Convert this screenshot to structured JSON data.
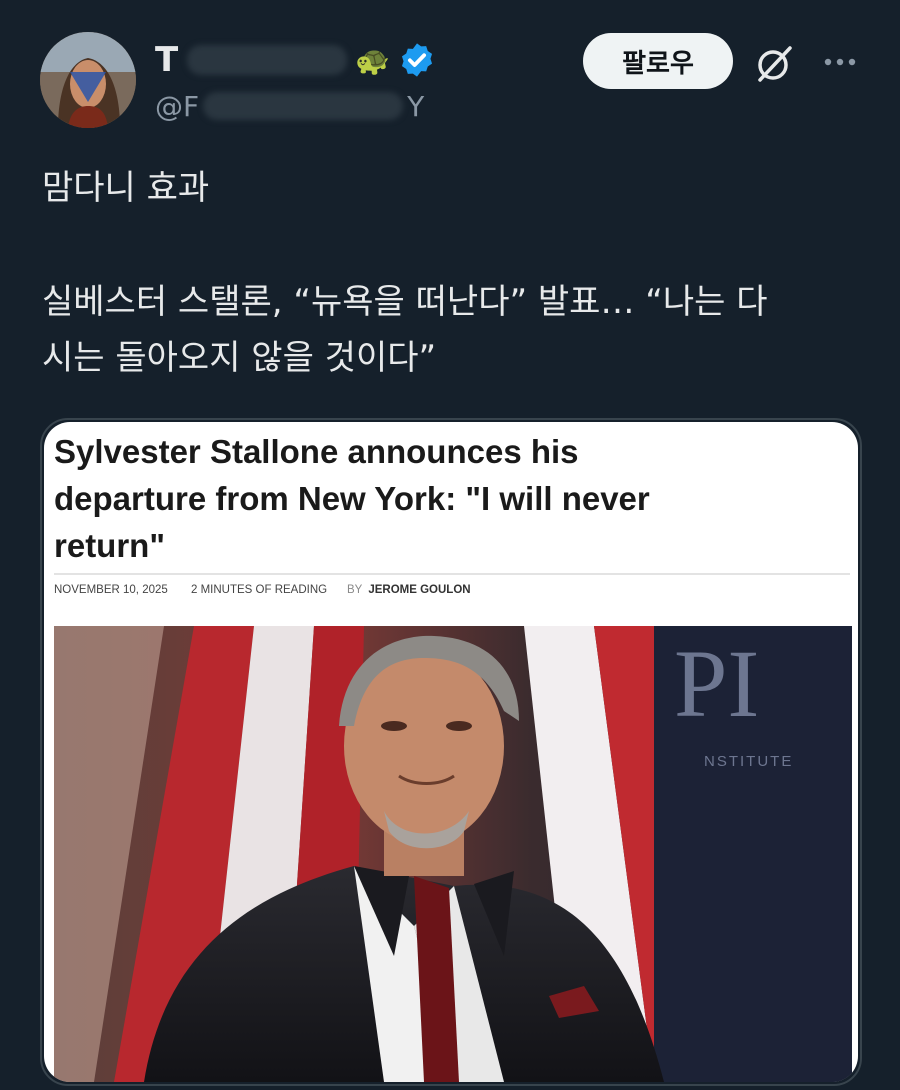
{
  "header": {
    "display_name": "T",
    "name_emoji": "🐢",
    "handle": "@F",
    "handle_tail": "Y",
    "follow_label": "팔로우",
    "more_icon": "more-dots-icon",
    "grok_icon": "grok-icon",
    "verified_icon": "verified-badge-icon",
    "verified_color": "#1d9bf0"
  },
  "tweet": {
    "line1": "맘다니 효과",
    "line2": "실베스터 스탤론, “뉴욕을 떠난다” 발표… “나는 다",
    "line3": "시는 돌아오지 않을 것이다”"
  },
  "card": {
    "title_line1": "Sylvester Stallone announces his",
    "title_line2": "departure from New York: \"I will never",
    "title_line3": "return\"",
    "date": "NOVEMBER 10, 2025",
    "reading_time": "2 MINUTES OF READING",
    "by": "BY",
    "author": "JEROME GOULON",
    "backdrop_letters": "PI",
    "backdrop_word": "NSTITUTE"
  }
}
